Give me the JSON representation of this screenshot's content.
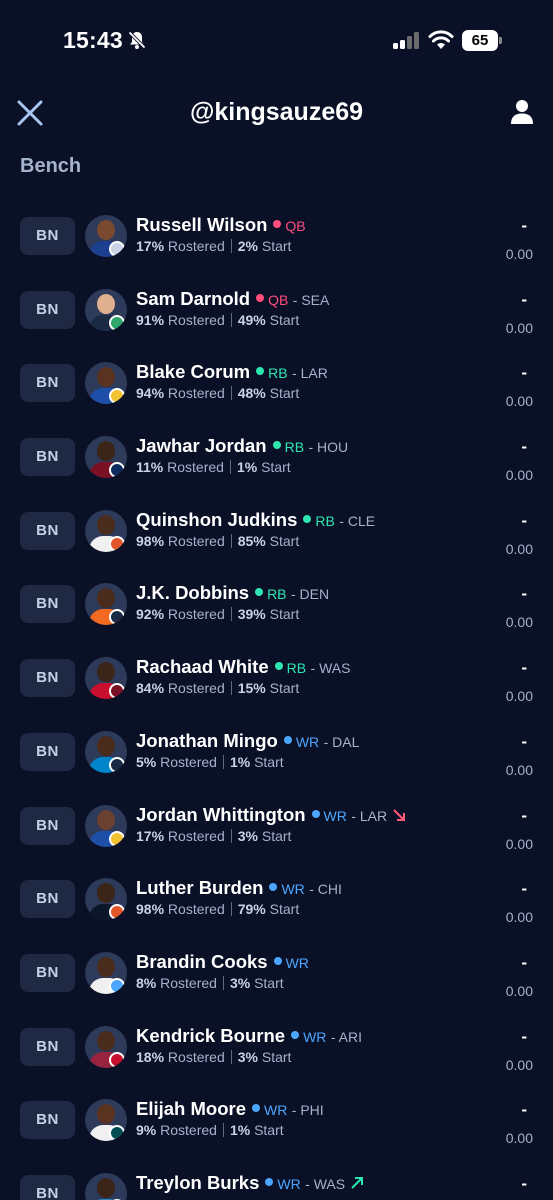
{
  "status_bar": {
    "time": "15:43",
    "battery": "65"
  },
  "header": {
    "title": "@kingsauze69"
  },
  "section": {
    "title": "Bench"
  },
  "colors": {
    "QB": "#ff4d7d",
    "RB": "#2ee6b0",
    "WR": "#4ca6ff",
    "trend_down": "#ff5a7a",
    "trend_up": "#2ee6b0"
  },
  "players": [
    {
      "slot": "BN",
      "name": "Russell Wilson",
      "pos": "QB",
      "team": "",
      "rostered_pct": "17%",
      "rostered_label": "Rostered",
      "start_pct": "2%",
      "start_label": "Start",
      "proj": "-",
      "points": "0.00",
      "trend": ""
    },
    {
      "slot": "BN",
      "name": "Sam Darnold",
      "pos": "QB",
      "team": "- SEA",
      "rostered_pct": "91%",
      "rostered_label": "Rostered",
      "start_pct": "49%",
      "start_label": "Start",
      "proj": "-",
      "points": "0.00",
      "trend": ""
    },
    {
      "slot": "BN",
      "name": "Blake Corum",
      "pos": "RB",
      "team": "- LAR",
      "rostered_pct": "94%",
      "rostered_label": "Rostered",
      "start_pct": "48%",
      "start_label": "Start",
      "proj": "-",
      "points": "0.00",
      "trend": ""
    },
    {
      "slot": "BN",
      "name": "Jawhar Jordan",
      "pos": "RB",
      "team": "- HOU",
      "rostered_pct": "11%",
      "rostered_label": "Rostered",
      "start_pct": "1%",
      "start_label": "Start",
      "proj": "-",
      "points": "0.00",
      "trend": ""
    },
    {
      "slot": "BN",
      "name": "Quinshon Judkins",
      "pos": "RB",
      "team": "- CLE",
      "rostered_pct": "98%",
      "rostered_label": "Rostered",
      "start_pct": "85%",
      "start_label": "Start",
      "proj": "-",
      "points": "0.00",
      "trend": ""
    },
    {
      "slot": "BN",
      "name": "J.K. Dobbins",
      "pos": "RB",
      "team": "- DEN",
      "rostered_pct": "92%",
      "rostered_label": "Rostered",
      "start_pct": "39%",
      "start_label": "Start",
      "proj": "-",
      "points": "0.00",
      "trend": ""
    },
    {
      "slot": "BN",
      "name": "Rachaad White",
      "pos": "RB",
      "team": "- WAS",
      "rostered_pct": "84%",
      "rostered_label": "Rostered",
      "start_pct": "15%",
      "start_label": "Start",
      "proj": "-",
      "points": "0.00",
      "trend": ""
    },
    {
      "slot": "BN",
      "name": "Jonathan Mingo",
      "pos": "WR",
      "team": "- DAL",
      "rostered_pct": "5%",
      "rostered_label": "Rostered",
      "start_pct": "1%",
      "start_label": "Start",
      "proj": "-",
      "points": "0.00",
      "trend": ""
    },
    {
      "slot": "BN",
      "name": "Jordan Whittington",
      "pos": "WR",
      "team": "- LAR",
      "rostered_pct": "17%",
      "rostered_label": "Rostered",
      "start_pct": "3%",
      "start_label": "Start",
      "proj": "-",
      "points": "0.00",
      "trend": "down"
    },
    {
      "slot": "BN",
      "name": "Luther Burden",
      "pos": "WR",
      "team": "- CHI",
      "rostered_pct": "98%",
      "rostered_label": "Rostered",
      "start_pct": "79%",
      "start_label": "Start",
      "proj": "-",
      "points": "0.00",
      "trend": ""
    },
    {
      "slot": "BN",
      "name": "Brandin Cooks",
      "pos": "WR",
      "team": "",
      "rostered_pct": "8%",
      "rostered_label": "Rostered",
      "start_pct": "3%",
      "start_label": "Start",
      "proj": "-",
      "points": "0.00",
      "trend": ""
    },
    {
      "slot": "BN",
      "name": "Kendrick Bourne",
      "pos": "WR",
      "team": "- ARI",
      "rostered_pct": "18%",
      "rostered_label": "Rostered",
      "start_pct": "3%",
      "start_label": "Start",
      "proj": "-",
      "points": "0.00",
      "trend": ""
    },
    {
      "slot": "BN",
      "name": "Elijah Moore",
      "pos": "WR",
      "team": "- PHI",
      "rostered_pct": "9%",
      "rostered_label": "Rostered",
      "start_pct": "1%",
      "start_label": "Start",
      "proj": "-",
      "points": "0.00",
      "trend": ""
    },
    {
      "slot": "BN",
      "name": "Treylon Burks",
      "pos": "WR",
      "team": "- WAS",
      "rostered_pct": "",
      "rostered_label": "",
      "start_pct": "",
      "start_label": "",
      "proj": "-",
      "points": "",
      "trend": "up"
    }
  ]
}
